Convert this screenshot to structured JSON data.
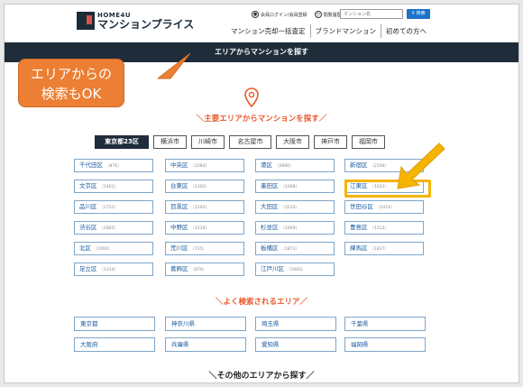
{
  "header": {
    "logo_top": "HOME4U",
    "logo_main": "マンションプライス",
    "user_links": [
      {
        "icon": "user-icon",
        "label": "会員ログイン/会員登録"
      },
      {
        "icon": "clock-icon",
        "label": "閲覧履歴"
      }
    ],
    "search_placeholder": "マンション名",
    "search_button": "検索",
    "nav": [
      "マンション売却一括査定",
      "ブランドマンション",
      "初めての方へ"
    ]
  },
  "title_bar": "エリアからマンションを探す",
  "callout": {
    "line1": "エリアからの",
    "line2": "検索もOK"
  },
  "main_section_title": "＼主要エリアからマンションを探す／",
  "tabs": [
    "東京都23区",
    "横浜市",
    "川崎市",
    "名古屋市",
    "大阪市",
    "神戸市",
    "福岡市"
  ],
  "active_tab": "東京都23区",
  "wards": [
    {
      "name": "千代田区",
      "count": "（876）"
    },
    {
      "name": "中央区",
      "count": "（1084）"
    },
    {
      "name": "港区",
      "count": "（2890）"
    },
    {
      "name": "新宿区",
      "count": "（2194）"
    },
    {
      "name": "文京区",
      "count": "（1461）"
    },
    {
      "name": "台東区",
      "count": "（1305）"
    },
    {
      "name": "墨田区",
      "count": "（1068）"
    },
    {
      "name": "江東区",
      "count": "（1621）"
    },
    {
      "name": "品川区",
      "count": "（1751）"
    },
    {
      "name": "目黒区",
      "count": "（1293）"
    },
    {
      "name": "大田区",
      "count": "（2533）"
    },
    {
      "name": "世田谷区",
      "count": "（3474）"
    },
    {
      "name": "渋谷区",
      "count": "（1865）"
    },
    {
      "name": "中野区",
      "count": "（1234）"
    },
    {
      "name": "杉並区",
      "count": "（1669）"
    },
    {
      "name": "豊島区",
      "count": "（1312）"
    },
    {
      "name": "北区",
      "count": "（1004）"
    },
    {
      "name": "荒川区",
      "count": "（715）"
    },
    {
      "name": "板橋区",
      "count": "（1871）"
    },
    {
      "name": "練馬区",
      "count": "（1837）"
    },
    {
      "name": "足立区",
      "count": "（1314）"
    },
    {
      "name": "葛飾区",
      "count": "（870）"
    },
    {
      "name": "江戸川区",
      "count": "（1083）"
    }
  ],
  "popular_section_title": "＼よく検索されるエリア／",
  "prefectures": [
    "東京都",
    "神奈川県",
    "埼玉県",
    "千葉県",
    "大阪府",
    "兵庫県",
    "愛知県",
    "福岡県"
  ],
  "other_section_title": "＼その他のエリアから探す／",
  "colors": {
    "navy": "#1f2d3b",
    "accent_orange": "#e85a2c",
    "callout": "#ec7f33",
    "highlight": "#f5b400",
    "link_blue": "#1a5aa0"
  }
}
